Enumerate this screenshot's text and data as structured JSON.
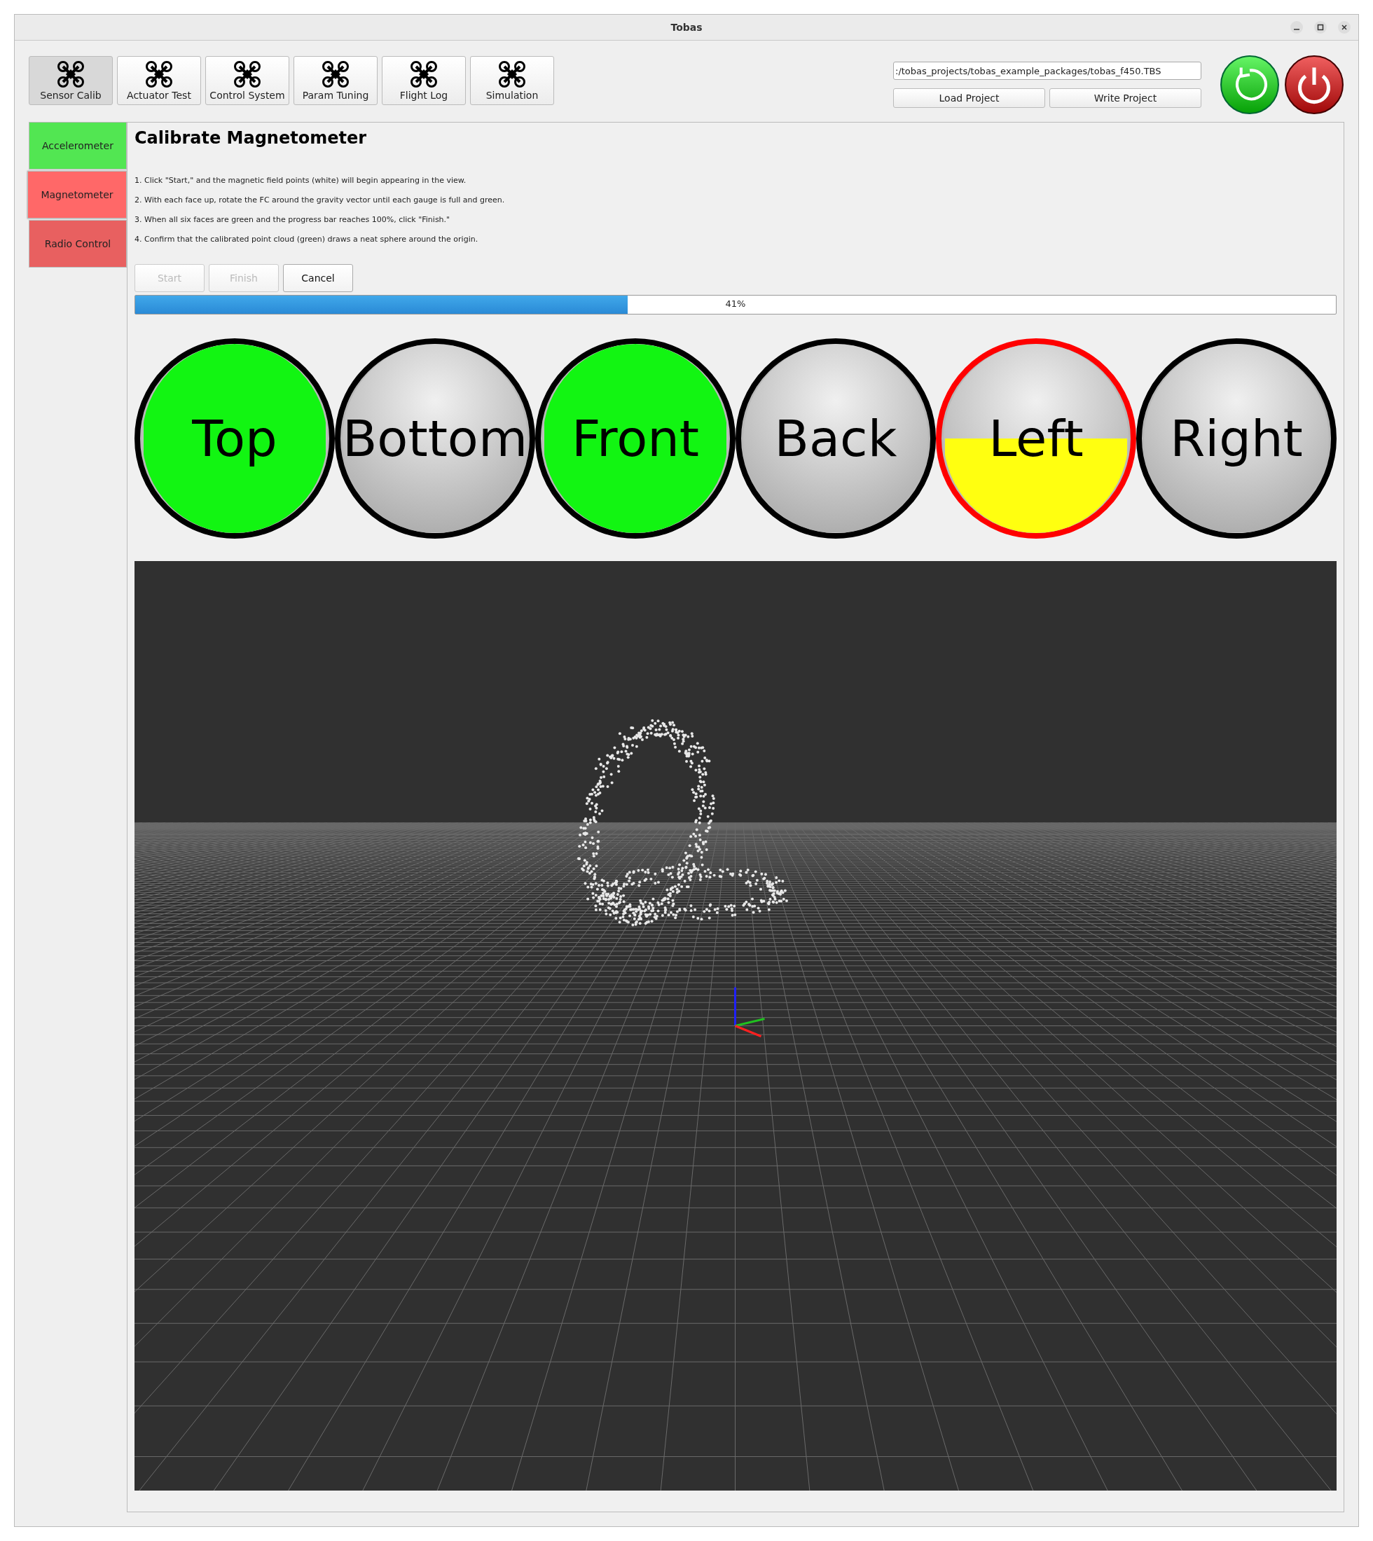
{
  "window": {
    "title": "Tobas"
  },
  "toolbar": [
    {
      "label": "Sensor Calib",
      "selected": true
    },
    {
      "label": "Actuator Test",
      "selected": false
    },
    {
      "label": "Control System",
      "selected": false
    },
    {
      "label": "Param Tuning",
      "selected": false
    },
    {
      "label": "Flight Log",
      "selected": false
    },
    {
      "label": "Simulation",
      "selected": false
    }
  ],
  "project": {
    "path": ":/tobas_projects/tobas_example_packages/tobas_f450.TBS",
    "buttons": [
      "Load Project",
      "Write Project"
    ]
  },
  "sidebar": {
    "items": [
      {
        "label": "Accelerometer",
        "color": "#52e652",
        "selected": false
      },
      {
        "label": "Magnetometer",
        "color": "#ff6868",
        "selected": true
      },
      {
        "label": "Radio Control",
        "color": "#e86060",
        "selected": false
      }
    ]
  },
  "panel": {
    "title": "Calibrate Magnetometer",
    "steps": [
      "1. Click \"Start,\" and the magnetic field points (white) will begin appearing in the view.",
      "2. With each face up, rotate the FC around the gravity vector until each gauge is full and green.",
      "3. When all six faces are green and the progress bar reaches 100%, click \"Finish.\"",
      "4. Confirm that the calibrated point cloud (green) draws a neat sphere around the origin."
    ],
    "buttons": [
      {
        "label": "Start",
        "disabled": true
      },
      {
        "label": "Finish",
        "disabled": true
      },
      {
        "label": "Cancel",
        "disabled": false
      }
    ],
    "progress": {
      "level": 0.41,
      "text": "41%"
    },
    "gauges": [
      {
        "label": "Top",
        "level": 1,
        "active": false
      },
      {
        "label": "Bottom",
        "level": 0,
        "active": false
      },
      {
        "label": "Front",
        "level": 1,
        "active": false
      },
      {
        "label": "Back",
        "level": 0,
        "active": false
      },
      {
        "label": "Left",
        "level": 0.5,
        "active": true
      },
      {
        "label": "Right",
        "level": 0,
        "active": false
      }
    ]
  }
}
